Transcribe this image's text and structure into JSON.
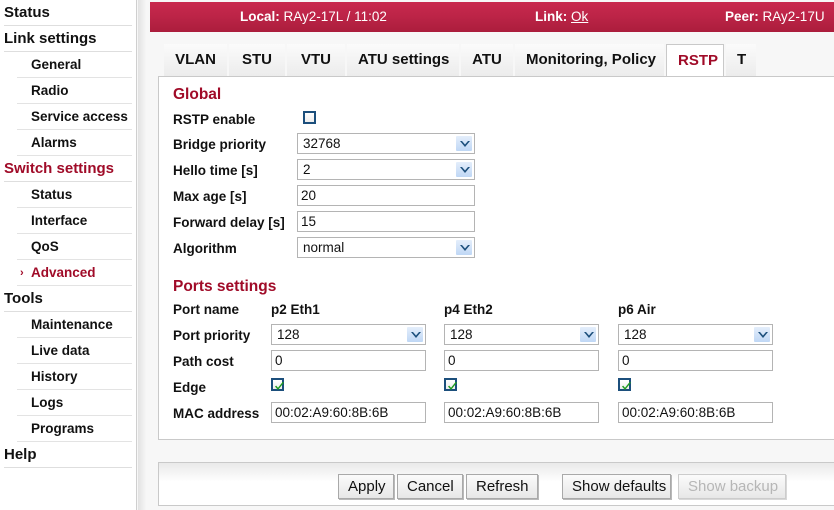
{
  "sidebar": {
    "items": [
      {
        "label": "Status",
        "level": "top",
        "active": false
      },
      {
        "label": "Link settings",
        "level": "top",
        "active": false
      },
      {
        "label": "General",
        "level": "sub",
        "active": false
      },
      {
        "label": "Radio",
        "level": "sub",
        "active": false
      },
      {
        "label": "Service access",
        "level": "sub",
        "active": false
      },
      {
        "label": "Alarms",
        "level": "sub",
        "active": false
      },
      {
        "label": "Switch settings",
        "level": "top",
        "active": true
      },
      {
        "label": "Status",
        "level": "sub",
        "active": false
      },
      {
        "label": "Interface",
        "level": "sub",
        "active": false
      },
      {
        "label": "QoS",
        "level": "sub",
        "active": false
      },
      {
        "label": "Advanced",
        "level": "sub",
        "active": true
      },
      {
        "label": "Tools",
        "level": "top",
        "active": false
      },
      {
        "label": "Maintenance",
        "level": "sub",
        "active": false
      },
      {
        "label": "Live data",
        "level": "sub",
        "active": false
      },
      {
        "label": "History",
        "level": "sub",
        "active": false
      },
      {
        "label": "Logs",
        "level": "sub",
        "active": false
      },
      {
        "label": "Programs",
        "level": "sub",
        "active": false
      },
      {
        "label": "Help",
        "level": "top",
        "active": false
      }
    ]
  },
  "statusbar": {
    "local_key": "Local:",
    "local_value": "RAy2-17L / 11:02",
    "link_key": "Link:",
    "link_value": "Ok",
    "peer_key": "Peer:",
    "peer_value": "RAy2-17U"
  },
  "tabs": [
    {
      "label": "VLAN",
      "active": false
    },
    {
      "label": "STU",
      "active": false
    },
    {
      "label": "VTU",
      "active": false
    },
    {
      "label": "ATU settings",
      "active": false
    },
    {
      "label": "ATU",
      "active": false
    },
    {
      "label": "Monitoring, Policy",
      "active": false
    },
    {
      "label": "RSTP",
      "active": true
    },
    {
      "label": "T",
      "active": false
    }
  ],
  "global": {
    "title": "Global",
    "rstp_enable": {
      "label": "RSTP enable",
      "checked": false
    },
    "bridge_priority": {
      "label": "Bridge priority",
      "value": "32768",
      "type": "select"
    },
    "hello_time": {
      "label": "Hello time [s]",
      "value": "2",
      "type": "select"
    },
    "max_age": {
      "label": "Max age [s]",
      "value": "20",
      "type": "text"
    },
    "forward_delay": {
      "label": "Forward delay [s]",
      "value": "15",
      "type": "text"
    },
    "algorithm": {
      "label": "Algorithm",
      "value": "normal",
      "type": "select"
    }
  },
  "ports": {
    "title": "Ports settings",
    "row_labels": {
      "port_name": "Port name",
      "port_priority": "Port priority",
      "path_cost": "Path cost",
      "edge": "Edge",
      "mac_address": "MAC address"
    },
    "columns": [
      {
        "port_name": "p2 Eth1",
        "port_priority": "128",
        "path_cost": "0",
        "edge": true,
        "mac_address": "00:02:A9:60:8B:6B"
      },
      {
        "port_name": "p4 Eth2",
        "port_priority": "128",
        "path_cost": "0",
        "edge": true,
        "mac_address": "00:02:A9:60:8B:6B"
      },
      {
        "port_name": "p6 Air",
        "port_priority": "128",
        "path_cost": "0",
        "edge": true,
        "mac_address": "00:02:A9:60:8B:6B"
      }
    ]
  },
  "buttons": [
    {
      "label": "Apply",
      "disabled": false
    },
    {
      "label": "Cancel",
      "disabled": false
    },
    {
      "label": "Refresh",
      "disabled": false
    },
    {
      "label": "Show defaults",
      "disabled": false
    },
    {
      "label": "Show backup",
      "disabled": true
    }
  ],
  "colors": {
    "brand_red": "#a00b28",
    "header_top": "#c9294e",
    "header_bottom": "#ab1d3c",
    "checkbox_border": "#1c4f7c",
    "check_green": "#1f9c1f"
  }
}
